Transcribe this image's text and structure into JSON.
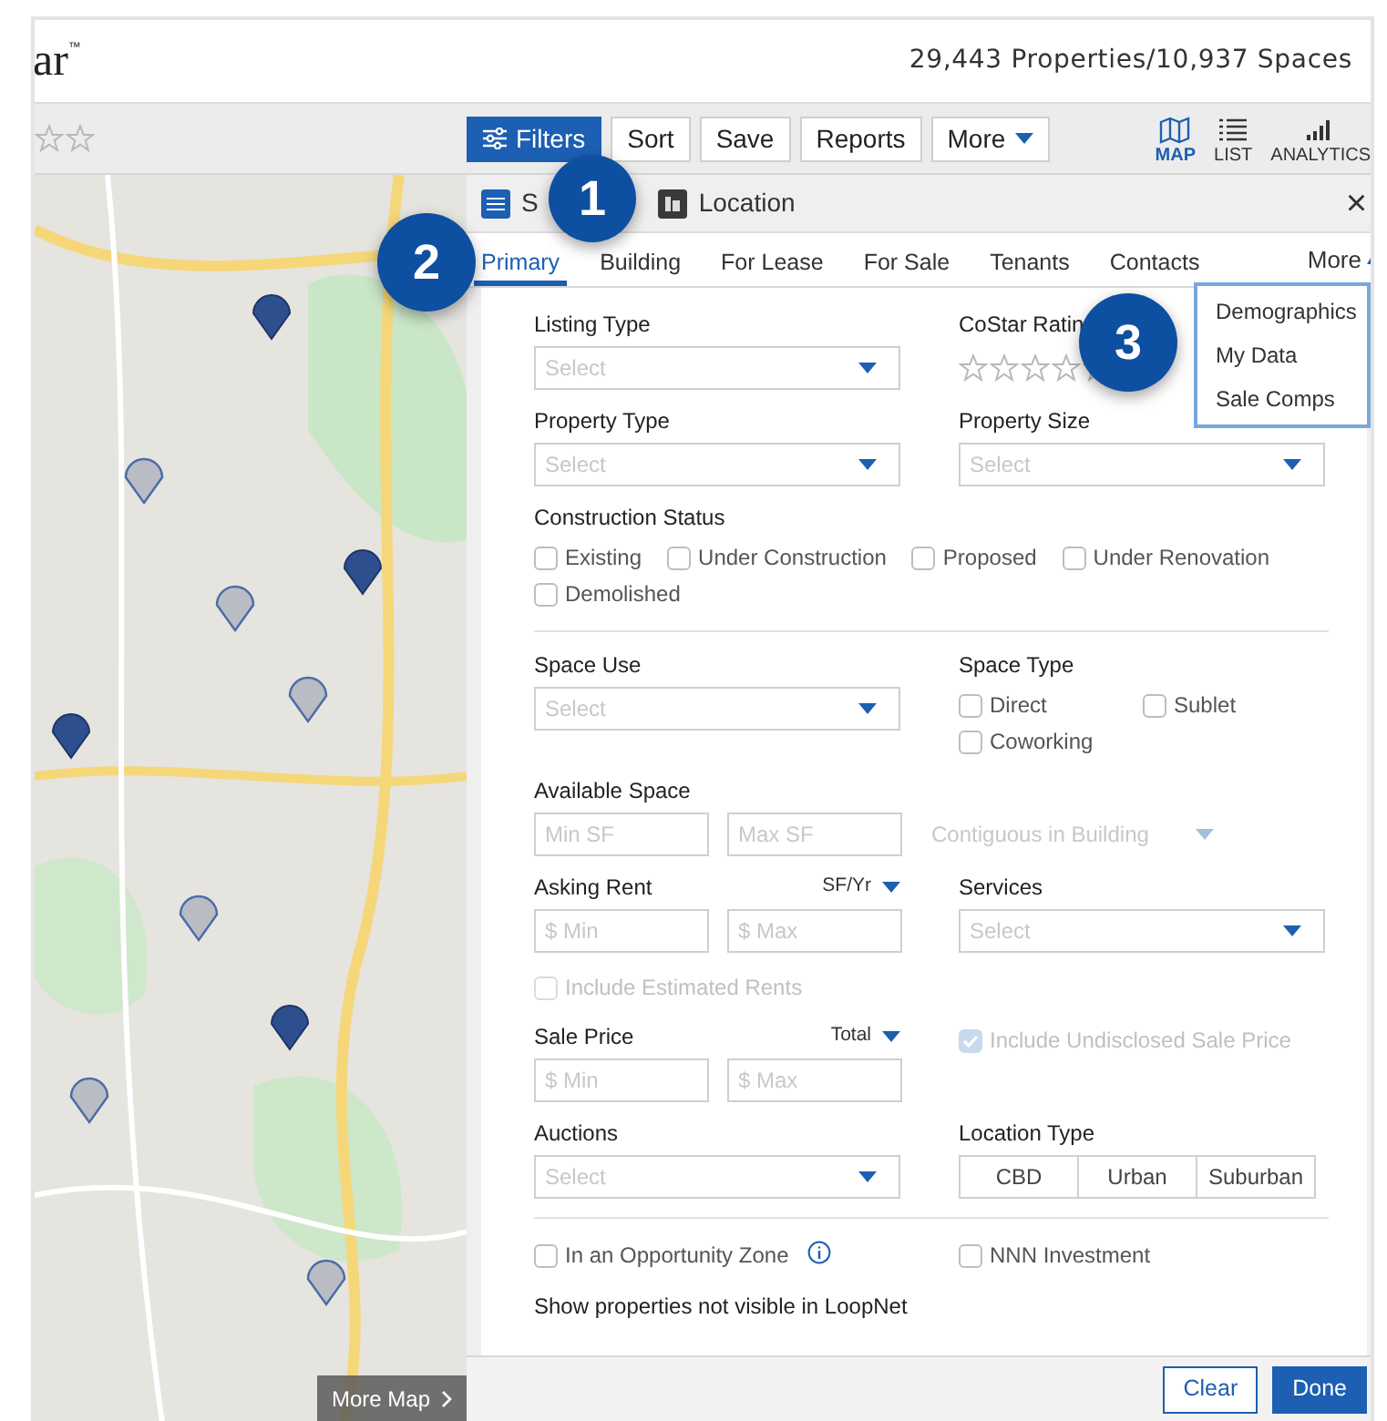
{
  "header": {
    "logo": "ar",
    "logo_mark": "™",
    "counts": "29,443 Properties/10,937 Spaces"
  },
  "toolbar": {
    "buttons": [
      {
        "label": "Filters",
        "kind": "filters",
        "selected": true
      },
      {
        "label": "Sort",
        "kind": "plain",
        "selected": false
      },
      {
        "label": "Save",
        "kind": "plain",
        "selected": false
      },
      {
        "label": "Reports",
        "kind": "plain",
        "selected": false
      },
      {
        "label": "More",
        "kind": "menu",
        "selected": false
      }
    ],
    "views": [
      {
        "label": "MAP",
        "kind": "map",
        "selected": true
      },
      {
        "label": "LIST",
        "kind": "list",
        "selected": false
      },
      {
        "label": "ANALYTICS",
        "kind": "analytics",
        "selected": false
      }
    ]
  },
  "map": {
    "kind": "picture",
    "button": "More Map"
  },
  "panel": {
    "header_tabs": [
      {
        "label": "S",
        "kind": "filters"
      },
      {
        "label": "Location",
        "kind": "location"
      }
    ],
    "close": "×",
    "tabs": [
      {
        "label": "Primary",
        "selected": true
      },
      {
        "label": "Building",
        "selected": false
      },
      {
        "label": "For Lease",
        "selected": false
      },
      {
        "label": "For Sale",
        "selected": false
      },
      {
        "label": "Tenants",
        "selected": false
      },
      {
        "label": "Contacts",
        "selected": false
      }
    ],
    "more": {
      "label": "More",
      "expanded": true
    },
    "menu": [
      "Demographics",
      "My Data",
      "Sale Comps"
    ],
    "sections": [
      {
        "rows": [
          {
            "cells": [
              {
                "kind": "select",
                "label": "Listing Type",
                "placeholder": "Select"
              },
              {
                "kind": "rating",
                "label": "CoStar Ratin",
                "stars": 0
              }
            ]
          },
          {
            "cells": [
              {
                "kind": "select",
                "label": "Property Type",
                "placeholder": "Select"
              },
              {
                "kind": "select",
                "label": "Property Size",
                "placeholder": "Select"
              }
            ]
          },
          {
            "cells": [
              {
                "kind": "checks",
                "label": "Construction Status",
                "items": [
                  {
                    "label": "Existing",
                    "checked": false,
                    "disabled": false
                  },
                  {
                    "label": "Under Construction",
                    "checked": false,
                    "disabled": false
                  },
                  {
                    "label": "Proposed",
                    "checked": false,
                    "disabled": false
                  },
                  {
                    "label": "Under Renovation",
                    "checked": false,
                    "disabled": false
                  },
                  {
                    "label": "Demolished",
                    "checked": false,
                    "disabled": false
                  }
                ]
              }
            ]
          }
        ]
      },
      {
        "rows": [
          {
            "cells": [
              {
                "kind": "select",
                "label": "Space Use",
                "placeholder": "Select"
              },
              {
                "kind": "checks",
                "label": "Space Type",
                "items": [
                  {
                    "label": "Direct",
                    "checked": false,
                    "disabled": false
                  },
                  {
                    "label": "Sublet",
                    "checked": false,
                    "disabled": false
                  },
                  {
                    "label": "Coworking",
                    "checked": false,
                    "disabled": false
                  }
                ]
              }
            ]
          },
          {
            "cells": [
              {
                "kind": "range",
                "label": "Available Space",
                "inputs": [
                  {
                    "placeholder": "Min SF"
                  },
                  {
                    "placeholder": "Max SF"
                  }
                ],
                "extra": {
                  "placeholder": "Contiguous in Building",
                  "disabled": true
                }
              }
            ]
          },
          {
            "cells": [
              {
                "kind": "range",
                "label": "Asking Rent",
                "unit": "SF/Yr",
                "inputs": [
                  {
                    "placeholder": "$ Min"
                  },
                  {
                    "placeholder": "$ Max"
                  }
                ]
              },
              {
                "kind": "select",
                "label": "Services",
                "placeholder": "Select"
              }
            ]
          },
          {
            "cells": [
              {
                "kind": "checkbox",
                "label": "Include Estimated Rents",
                "checked": false,
                "disabled": true
              }
            ]
          },
          {
            "cells": [
              {
                "kind": "range",
                "label": "Sale Price",
                "unit": "Total",
                "inputs": [
                  {
                    "placeholder": "$ Min"
                  },
                  {
                    "placeholder": "$ Max"
                  }
                ]
              },
              {
                "kind": "checkbox",
                "label": "Include Undisclosed Sale Price",
                "checked": true,
                "disabled": true
              }
            ]
          },
          {
            "cells": [
              {
                "kind": "select",
                "label": "Auctions",
                "placeholder": "Select"
              },
              {
                "kind": "segmented",
                "label": "Location Type",
                "options": [
                  {
                    "label": "CBD",
                    "selected": false
                  },
                  {
                    "label": "Urban",
                    "selected": false
                  },
                  {
                    "label": "Suburban",
                    "selected": false
                  }
                ]
              }
            ]
          }
        ]
      },
      {
        "rows": [
          {
            "cells": [
              {
                "kind": "checkbox",
                "label": "In an Opportunity Zone",
                "checked": false,
                "disabled": false,
                "info": true
              },
              {
                "kind": "checkbox",
                "label": "NNN Investment",
                "checked": false,
                "disabled": false
              }
            ]
          },
          {
            "cells": [
              {
                "kind": "heading",
                "label": "Show properties not visible in LoopNet"
              }
            ]
          }
        ]
      }
    ],
    "footer": [
      {
        "label": "Clear",
        "kind": "secondary"
      },
      {
        "label": "Done",
        "kind": "primary"
      }
    ]
  },
  "callouts": [
    "1",
    "2",
    "3"
  ]
}
